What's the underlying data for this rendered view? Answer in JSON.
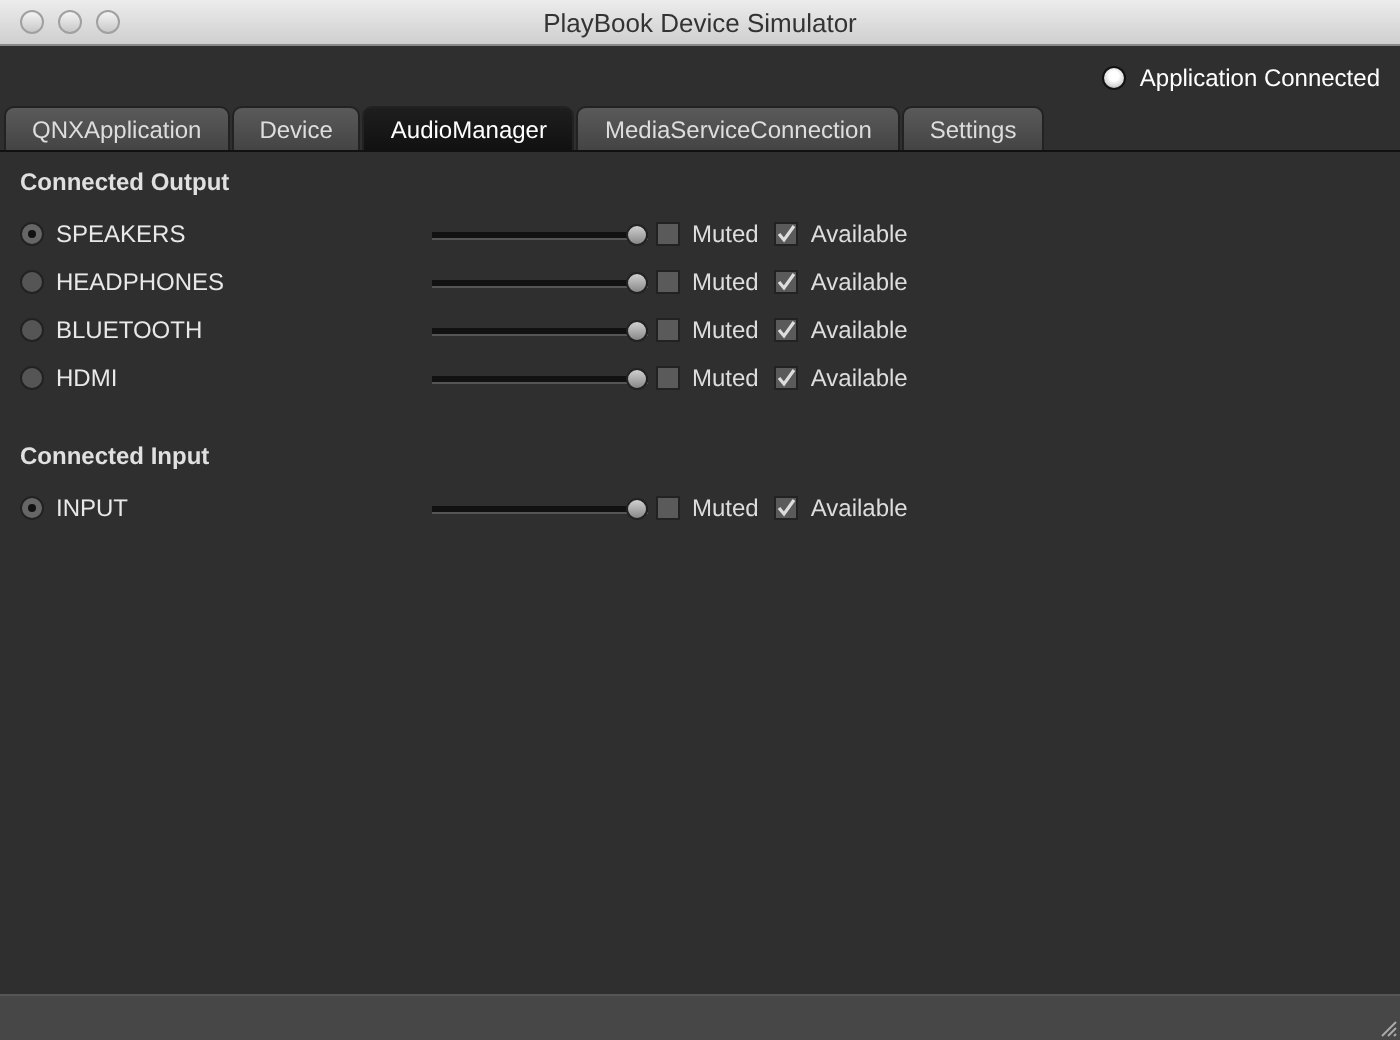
{
  "window": {
    "title": "PlayBook Device Simulator"
  },
  "connection": {
    "label": "Application Connected",
    "on": true
  },
  "tabs": [
    {
      "label": "QNXApplication",
      "selected": false
    },
    {
      "label": "Device",
      "selected": false
    },
    {
      "label": "AudioManager",
      "selected": true
    },
    {
      "label": "MediaServiceConnection",
      "selected": false
    },
    {
      "label": "Settings",
      "selected": false
    }
  ],
  "sections": [
    {
      "title": "Connected Output",
      "devices": [
        {
          "name": "SPEAKERS",
          "selected": true,
          "level": 1,
          "muted_label": "Muted",
          "muted": false,
          "available_label": "Available",
          "available": true
        },
        {
          "name": "HEADPHONES",
          "selected": false,
          "level": 1,
          "muted_label": "Muted",
          "muted": false,
          "available_label": "Available",
          "available": true
        },
        {
          "name": "BLUETOOTH",
          "selected": false,
          "level": 1,
          "muted_label": "Muted",
          "muted": false,
          "available_label": "Available",
          "available": true
        },
        {
          "name": "HDMI",
          "selected": false,
          "level": 1,
          "muted_label": "Muted",
          "muted": false,
          "available_label": "Available",
          "available": true
        }
      ]
    },
    {
      "title": "Connected Input",
      "devices": [
        {
          "name": "INPUT",
          "selected": true,
          "level": 1,
          "muted_label": "Muted",
          "muted": false,
          "available_label": "Available",
          "available": true
        }
      ]
    }
  ]
}
